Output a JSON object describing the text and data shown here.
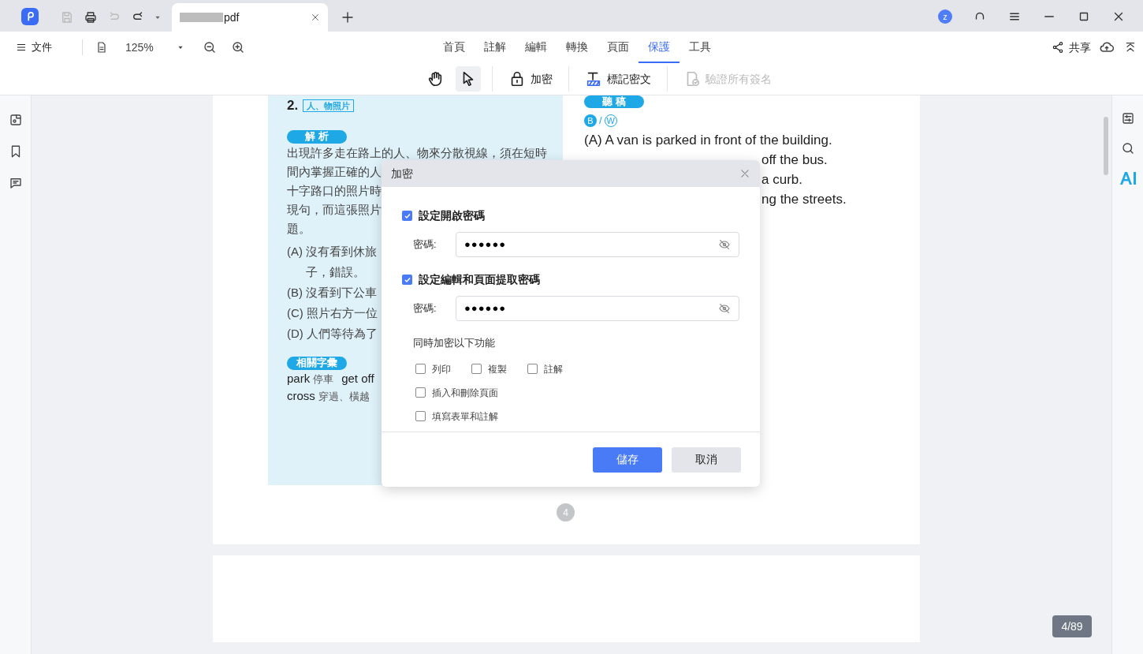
{
  "title_bar": {
    "tab": {
      "title": "pdf"
    },
    "avatar": "z"
  },
  "menu": {
    "file": "文件",
    "zoom": "125%",
    "ribbon_tabs": [
      {
        "label": "首頁",
        "selected": false
      },
      {
        "label": "註解",
        "selected": false
      },
      {
        "label": "編輯",
        "selected": false
      },
      {
        "label": "轉換",
        "selected": false
      },
      {
        "label": "頁面",
        "selected": false
      },
      {
        "label": "保護",
        "selected": true
      },
      {
        "label": "工具",
        "selected": false
      }
    ],
    "share": "共享"
  },
  "tools": [
    {
      "kind": "hand",
      "selected": false,
      "disabled": false
    },
    {
      "kind": "pointer",
      "selected": true,
      "disabled": false
    },
    {
      "kind": "lock",
      "label": "加密",
      "selected": false,
      "disabled": false
    },
    {
      "kind": "redact",
      "label": "標記密文",
      "selected": false,
      "disabled": false
    },
    {
      "kind": "verify",
      "label": "驗證所有簽名",
      "selected": false,
      "disabled": true
    }
  ],
  "document": {
    "left": {
      "number": "2.",
      "tag": "人、物照片",
      "analysis_label": "解 析",
      "paragraph": [
        "出現許多走在路上的人、物來分散視線，須在短時",
        "間內掌握正確的人",
        "十字路口的照片時",
        "現句，而這張照片",
        "題。"
      ],
      "options": [
        [
          "(A) 沒有看到休旅",
          "子，錯誤。"
        ],
        [
          "(B) 沒看到下公車"
        ],
        [
          "(C) 照片右方一位"
        ],
        [
          "(D) 人們等待為了"
        ]
      ],
      "vocab_label": "相關字彙",
      "vocab": [
        [
          "park",
          "停車",
          "get off"
        ],
        [
          "cross",
          "穿過、橫越"
        ]
      ]
    },
    "right": {
      "transcript_label": "聽 稿",
      "answer": [
        "B",
        "/",
        "W"
      ],
      "lines": [
        "(A) A van is parked in front of the building.",
        "off the bus.",
        "a curb.",
        "ng the streets."
      ]
    },
    "page_number": "4"
  },
  "dialog": {
    "title": "加密",
    "sections": [
      {
        "label": "設定開啟密碼",
        "checked": true,
        "field_label": "密碼:",
        "value": "●●●●●●"
      },
      {
        "label": "設定編輯和頁面提取密碼",
        "checked": true,
        "field_label": "密碼:",
        "value": "●●●●●●"
      }
    ],
    "features_label": "同時加密以下功能",
    "options": [
      [
        {
          "label": "列印",
          "checked": false
        },
        {
          "label": "複製",
          "checked": false
        },
        {
          "label": "註解",
          "checked": false
        }
      ],
      [
        {
          "label": "插入和刪除頁面",
          "checked": false
        }
      ],
      [
        {
          "label": "填寫表單和註解",
          "checked": false
        }
      ]
    ],
    "buttons": [
      "儲存",
      "取消"
    ]
  },
  "page_counter": "4/89"
}
